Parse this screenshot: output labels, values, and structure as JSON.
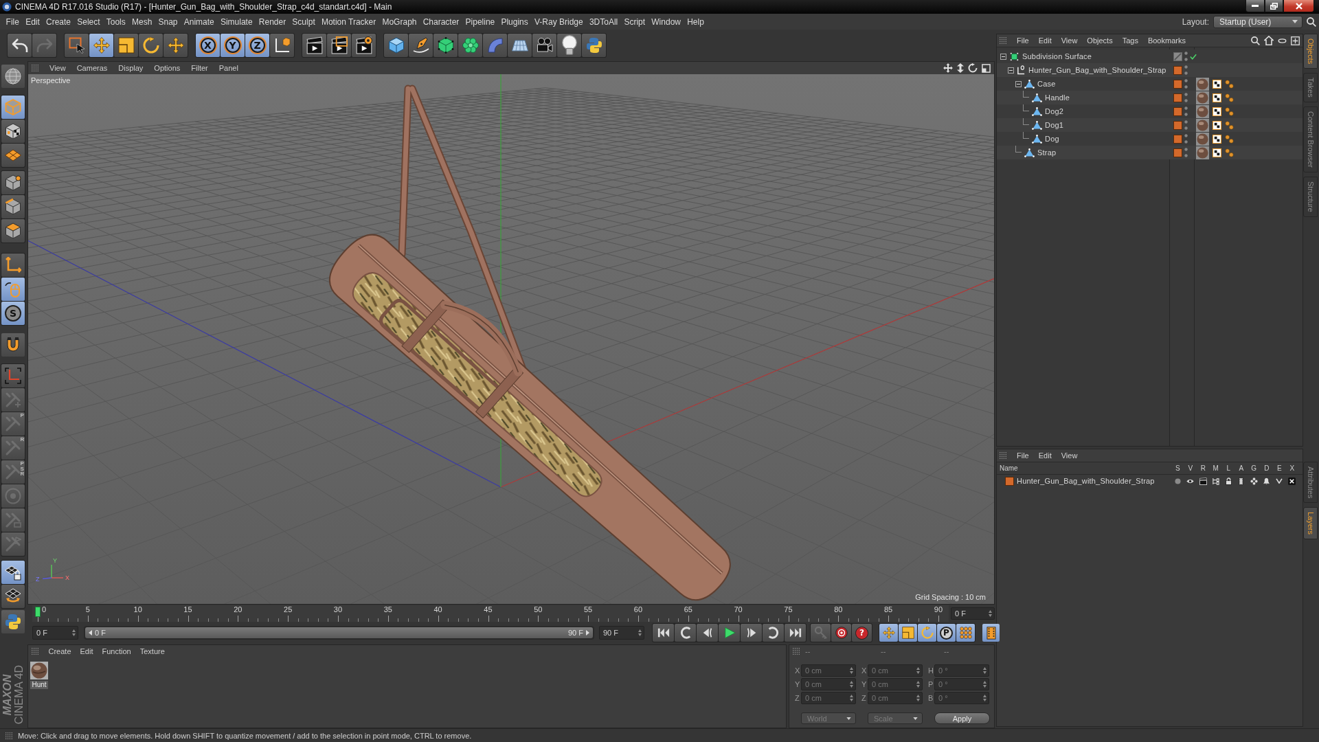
{
  "window": {
    "title": "CINEMA 4D R17.016 Studio (R17) - [Hunter_Gun_Bag_with_Shoulder_Strap_c4d_standart.c4d] - Main"
  },
  "menu_bar": {
    "items": [
      "File",
      "Edit",
      "Create",
      "Select",
      "Tools",
      "Mesh",
      "Snap",
      "Animate",
      "Simulate",
      "Render",
      "Sculpt",
      "Motion Tracker",
      "MoGraph",
      "Character",
      "Pipeline",
      "Plugins",
      "V-Ray Bridge",
      "3DToAll",
      "Script",
      "Window",
      "Help"
    ],
    "layout_label": "Layout:",
    "layout_value": "Startup (User)"
  },
  "toolbar": [
    [
      {
        "selected": false,
        "disabled": false
      },
      {
        "selected": false,
        "disabled": true
      }
    ],
    [
      {
        "selected": false,
        "disabled": false
      },
      {
        "selected": true,
        "disabled": false
      },
      {
        "selected": false,
        "disabled": false
      },
      {
        "selected": false,
        "disabled": false
      },
      {
        "selected": false,
        "disabled": false
      }
    ],
    [
      {
        "label": "X",
        "selected": true,
        "disabled": false
      },
      {
        "label": "Y",
        "selected": true,
        "disabled": false
      },
      {
        "label": "Z",
        "selected": true,
        "disabled": false
      },
      {
        "selected": false,
        "disabled": false
      }
    ],
    [
      {
        "selected": false,
        "disabled": false
      },
      {
        "selected": false,
        "disabled": false
      },
      {
        "selected": false,
        "disabled": false
      }
    ],
    [
      {
        "selected": false,
        "disabled": false
      },
      {
        "selected": false,
        "disabled": false
      },
      {
        "selected": false,
        "disabled": false
      },
      {
        "selected": false,
        "disabled": false
      },
      {
        "selected": false,
        "disabled": false
      },
      {
        "selected": false,
        "disabled": false
      },
      {
        "selected": false,
        "disabled": false
      },
      {
        "selected": false,
        "disabled": false
      },
      {
        "selected": false,
        "disabled": false
      }
    ]
  ],
  "mode_toolbar": [
    [
      {
        "selected": false,
        "disabled": false
      }
    ],
    [
      {
        "selected": true,
        "disabled": false
      },
      {
        "selected": false,
        "disabled": false
      },
      {
        "selected": false,
        "disabled": false
      }
    ],
    [
      {
        "selected": false,
        "disabled": false
      },
      {
        "selected": false,
        "disabled": false
      },
      {
        "selected": false,
        "disabled": false
      }
    ],
    [
      {
        "selected": false,
        "disabled": false
      },
      {
        "selected": true,
        "disabled": false
      },
      {
        "label": "S",
        "selected": true,
        "disabled": false
      }
    ],
    [
      {
        "selected": false,
        "disabled": false
      }
    ],
    [
      {
        "selected": false,
        "disabled": false
      },
      {
        "selected": false,
        "disabled": true
      },
      {
        "label": "P",
        "selected": false,
        "disabled": true
      },
      {
        "label": "R",
        "selected": false,
        "disabled": true
      },
      {
        "label": "PSR",
        "selected": false,
        "disabled": true
      },
      {
        "selected": false,
        "disabled": true
      },
      {
        "selected": false,
        "disabled": true
      },
      {
        "selected": false,
        "disabled": true
      }
    ],
    [
      {
        "selected": true,
        "disabled": false
      },
      {
        "selected": false,
        "disabled": false
      }
    ],
    [
      {
        "selected": false,
        "disabled": false
      }
    ]
  ],
  "viewport": {
    "menu": [
      "View",
      "Cameras",
      "Display",
      "Options",
      "Filter",
      "Panel"
    ],
    "camera": "Perspective",
    "grid_spacing": "Grid Spacing : 10 cm",
    "axis_labels": [
      "Y",
      "Z",
      "X"
    ]
  },
  "timeline": {
    "ticks": [
      "0",
      "5",
      "10",
      "15",
      "20",
      "25",
      "30",
      "35",
      "40",
      "45",
      "50",
      "55",
      "60",
      "65",
      "70",
      "75",
      "80",
      "85",
      "90"
    ],
    "level": 0,
    "current_frame": "0 F"
  },
  "playback": {
    "start_frame": "0 F",
    "range_start": "0 F",
    "range_end": "90 F",
    "level": 1,
    "end_frame": "90 F",
    "buttons": [
      [
        {
          "selected": false,
          "disabled": false
        },
        {
          "selected": false,
          "disabled": false
        },
        {
          "selected": false,
          "disabled": false
        },
        {
          "selected": false,
          "disabled": false
        },
        {
          "selected": false,
          "disabled": false
        },
        {
          "selected": false,
          "disabled": false
        },
        {
          "selected": false,
          "disabled": false
        }
      ],
      [
        {
          "selected": false,
          "disabled": true
        },
        {
          "selected": false,
          "disabled": false
        },
        {
          "label": "?",
          "selected": false,
          "disabled": false
        }
      ],
      [
        {
          "selected": true,
          "disabled": false
        },
        {
          "selected": true,
          "disabled": false
        },
        {
          "selected": true,
          "disabled": false
        },
        {
          "label": "P",
          "selected": true,
          "disabled": false
        },
        {
          "selected": true,
          "disabled": false
        }
      ],
      [
        {
          "selected": true,
          "disabled": false
        }
      ]
    ]
  },
  "material_manager": {
    "menu": [
      "Create",
      "Edit",
      "Function",
      "Texture"
    ],
    "materials": [
      {
        "name": "Hunt"
      }
    ]
  },
  "coordinates": {
    "headers": [
      "--",
      "--",
      "--"
    ],
    "rows": [
      {
        "axis": "X",
        "position": "0 cm",
        "size_axis": "X",
        "size": "0 cm",
        "rotation_axis": "H",
        "rotation": "0 °"
      },
      {
        "axis": "Y",
        "position": "0 cm",
        "size_axis": "Y",
        "size": "0 cm",
        "rotation_axis": "P",
        "rotation": "0 °"
      },
      {
        "axis": "Z",
        "position": "0 cm",
        "size_axis": "Z",
        "size": "0 cm",
        "rotation_axis": "B",
        "rotation": "0 °"
      }
    ],
    "coordinate_system": "World",
    "transform_mode": "Scale",
    "apply": "Apply",
    "disabled": true
  },
  "brand": {
    "company": "MAXON",
    "product": "CINEMA 4D"
  },
  "status_bar": {
    "text": "Move: Click and drag to move elements. Hold down SHIFT to quantize movement / add to the selection in point mode, CTRL to remove."
  },
  "object_manager": {
    "menu": [
      "File",
      "Edit",
      "View",
      "Objects",
      "Tags",
      "Bookmarks"
    ],
    "objects": [
      {
        "name": "Subdivision Surface",
        "kind": "subdivision",
        "expanded": true,
        "enabled": true,
        "tagged": false,
        "children": [
          {
            "name": "Hunter_Gun_Bag_with_Shoulder_Strap",
            "kind": "null",
            "color": "#d4692b",
            "expanded": true,
            "tagged": false,
            "children": [
              {
                "name": "Case",
                "kind": "polygon",
                "color": "#d4692b",
                "expanded": true,
                "tagged": true,
                "children": [
                  {
                    "name": "Handle",
                    "kind": "polygon",
                    "color": "#d4692b",
                    "tagged": true
                  },
                  {
                    "name": "Dog2",
                    "kind": "polygon",
                    "color": "#d4692b",
                    "tagged": true
                  },
                  {
                    "name": "Dog1",
                    "kind": "polygon",
                    "color": "#d4692b",
                    "tagged": true
                  },
                  {
                    "name": "Dog",
                    "kind": "polygon",
                    "color": "#d4692b",
                    "tagged": true
                  }
                ]
              },
              {
                "name": "Strap",
                "kind": "polygon",
                "color": "#d4692b",
                "tagged": true
              }
            ]
          }
        ]
      }
    ]
  },
  "layer_manager": {
    "menu": [
      "File",
      "Edit",
      "View"
    ],
    "columns": [
      "Name",
      "S",
      "V",
      "R",
      "M",
      "L",
      "A",
      "G",
      "D",
      "E",
      "X"
    ],
    "layers": [
      {
        "name": "Hunter_Gun_Bag_with_Shoulder_Strap",
        "color": "#d4692b"
      }
    ]
  },
  "side_tabs": {
    "upper": [
      {
        "label": "Objects",
        "selected": true
      },
      {
        "label": "Takes",
        "selected": false
      },
      {
        "label": "Content Browser",
        "selected": false
      },
      {
        "label": "Structure",
        "selected": false
      }
    ],
    "lower": [
      {
        "label": "Attributes",
        "selected": false
      },
      {
        "label": "Layers",
        "selected": true
      }
    ]
  }
}
